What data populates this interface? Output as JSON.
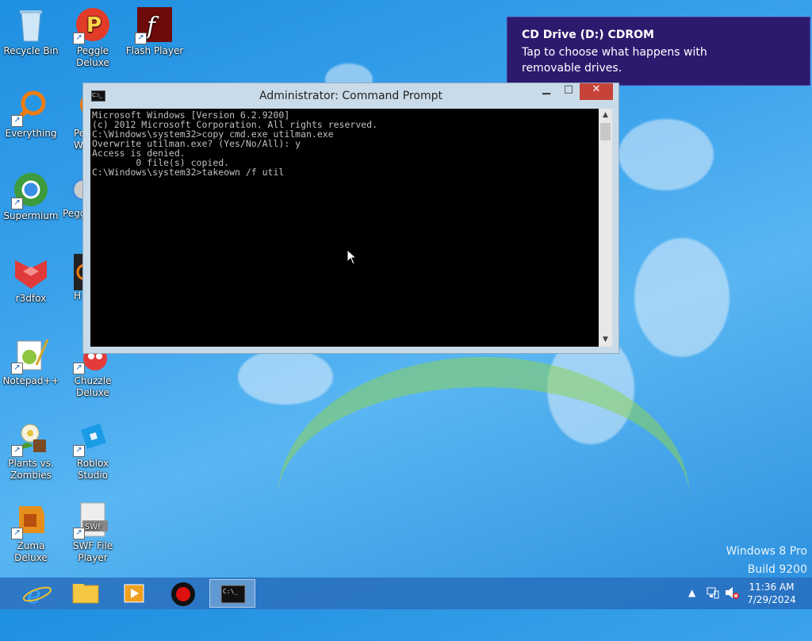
{
  "desktop": {
    "icons": [
      {
        "label": "Recycle Bin",
        "icon": "recycle-bin-icon"
      },
      {
        "label": "Peggle Deluxe",
        "icon": "peggle-icon"
      },
      {
        "label": "Flash Player",
        "icon": "flash-icon"
      },
      {
        "label": "Everything",
        "icon": "everything-icon"
      },
      {
        "label": "Supermium",
        "icon": "supermium-icon"
      },
      {
        "label": "r3dfox",
        "icon": "r3dfox-icon"
      },
      {
        "label": "Notepad++",
        "icon": "notepad-plus-icon"
      },
      {
        "label": "Chuzzle Deluxe",
        "icon": "chuzzle-icon"
      },
      {
        "label": "Plants vs. Zombies",
        "icon": "pvz-icon"
      },
      {
        "label": "Roblox Studio",
        "icon": "roblox-studio-icon"
      },
      {
        "label": "Zuma Deluxe",
        "icon": "zuma-icon"
      },
      {
        "label": "SWF File Player",
        "icon": "swf-player-icon"
      }
    ],
    "partial_labels": [
      "Pe",
      "W",
      "Pegg",
      "H"
    ]
  },
  "notification": {
    "title": "CD Drive (D:) CDROM",
    "message": "Tap to choose what happens with removable drives."
  },
  "console_window": {
    "title": "Administrator: Command Prompt",
    "icon_text": "C:\\_",
    "lines": [
      "Microsoft Windows [Version 6.2.9200]",
      "(c) 2012 Microsoft Corporation. All rights reserved.",
      "",
      "C:\\Windows\\system32>copy cmd.exe utilman.exe",
      "Overwrite utilman.exe? (Yes/No/All): y",
      "Access is denied.",
      "        0 file(s) copied.",
      "",
      "C:\\Windows\\system32>takeown /f util"
    ]
  },
  "watermark": {
    "line1": "Windows 8 Pro",
    "line2": "Build 9200"
  },
  "taskbar": {
    "items": [
      "internet-explorer-icon",
      "file-explorer-icon",
      "media-player-icon",
      "record-icon",
      "command-prompt-icon"
    ],
    "clock": {
      "time": "11:36 AM",
      "date": "7/29/2024"
    }
  },
  "colors": {
    "notification_bg": "#2c1a6e",
    "close_button": "#c7433a",
    "console_bg": "#000000"
  }
}
